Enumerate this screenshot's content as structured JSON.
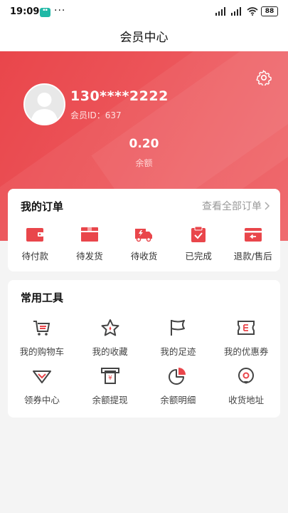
{
  "status": {
    "time": "19:09",
    "battery": "88"
  },
  "header": {
    "title": "会员中心"
  },
  "profile": {
    "phone": "130****2222",
    "member_id": "会员ID：637",
    "balance": "0.20",
    "balance_label": "余额"
  },
  "orders": {
    "title": "我的订单",
    "view_all": "查看全部订单",
    "items": [
      {
        "label": "待付款",
        "icon": "wallet-icon"
      },
      {
        "label": "待发货",
        "icon": "box-icon"
      },
      {
        "label": "待收货",
        "icon": "truck-icon"
      },
      {
        "label": "已完成",
        "icon": "clipboard-check-icon"
      },
      {
        "label": "退款/售后",
        "icon": "refund-icon"
      }
    ]
  },
  "tools": {
    "title": "常用工具",
    "items": [
      {
        "label": "我的购物车",
        "icon": "cart-icon"
      },
      {
        "label": "我的收藏",
        "icon": "star-icon"
      },
      {
        "label": "我的足迹",
        "icon": "flag-icon"
      },
      {
        "label": "我的优惠券",
        "icon": "coupon-icon"
      },
      {
        "label": "领券中心",
        "icon": "diamond-icon"
      },
      {
        "label": "余额提现",
        "icon": "atm-icon"
      },
      {
        "label": "余额明细",
        "icon": "pie-chart-icon"
      },
      {
        "label": "收货地址",
        "icon": "location-pin-icon"
      }
    ]
  },
  "colors": {
    "accent": "#e9464b",
    "icon_dark": "#444444"
  }
}
